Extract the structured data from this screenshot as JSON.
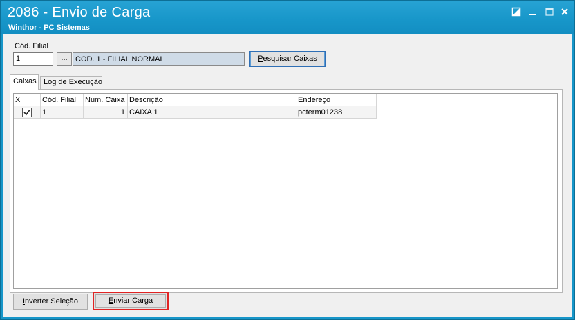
{
  "window": {
    "title": "2086 - Envio de Carga",
    "subtitle": "Winthor - PC Sistemas",
    "icons": [
      "restore-icon",
      "minimize-icon",
      "maximize-icon",
      "close-icon"
    ]
  },
  "filter": {
    "label": "Cód. Filial",
    "filial_value": "1",
    "dots_label": "...",
    "filial_description": "COD. 1 - FILIAL NORMAL",
    "search_button": {
      "underlined": "P",
      "rest": "esquisar Caixas"
    }
  },
  "tabs": [
    {
      "label": "Caixas",
      "active": true
    },
    {
      "label": "Log de Execução",
      "active": false
    }
  ],
  "grid": {
    "columns": [
      "X",
      "Cód. Filial",
      "Num. Caixa",
      "Descrição",
      "Endereço"
    ],
    "rows": [
      {
        "checked": true,
        "filial": "1",
        "num_caixa": "1",
        "descricao": "CAIXA 1",
        "endereco": "pcterm01238"
      }
    ]
  },
  "footer": {
    "invert_button": {
      "underlined": "I",
      "rest": "nverter Seleção"
    },
    "send_button": {
      "underlined": "E",
      "rest": "nviar Carga"
    }
  },
  "colors": {
    "titlebar": "#1796c9",
    "highlight": "#e02424",
    "description_field": "#cfdbe7"
  }
}
